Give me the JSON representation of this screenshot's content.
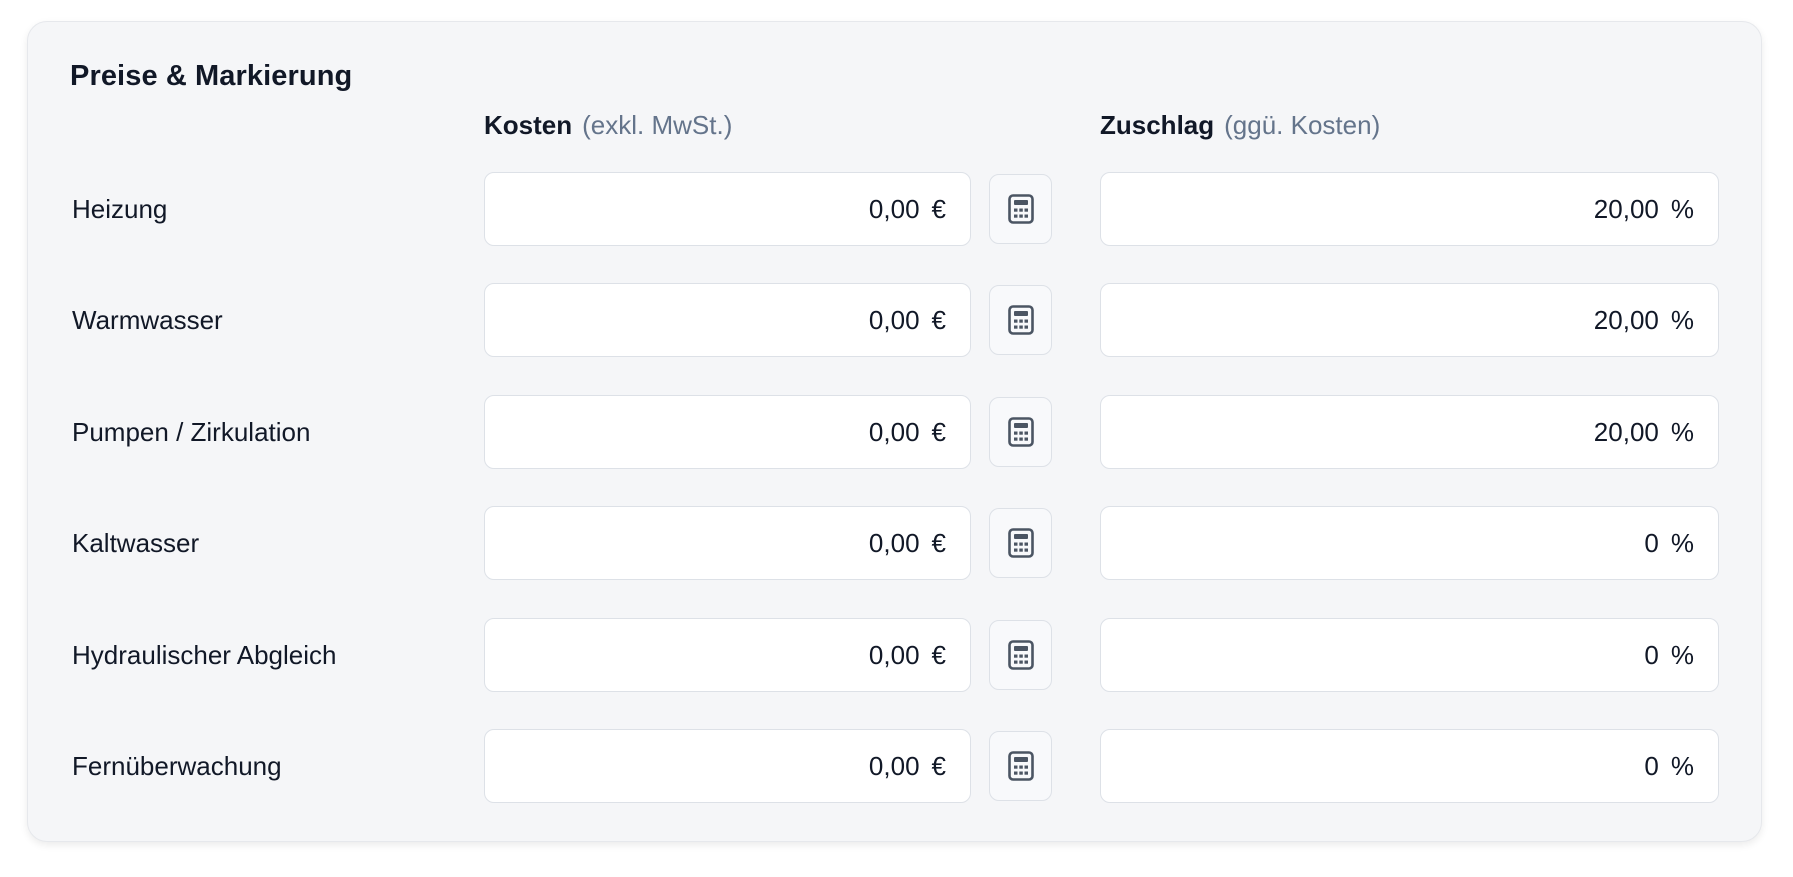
{
  "section": {
    "title": "Preise & Markierung"
  },
  "columns": {
    "cost": {
      "label": "Kosten",
      "hint": "(exkl. MwSt.)"
    },
    "markup": {
      "label": "Zuschlag",
      "hint": "(ggü. Kosten)"
    }
  },
  "rows": [
    {
      "label": "Heizung",
      "cost": "0,00",
      "cost_unit": "€",
      "markup": "20,00",
      "markup_unit": "%"
    },
    {
      "label": "Warmwasser",
      "cost": "0,00",
      "cost_unit": "€",
      "markup": "20,00",
      "markup_unit": "%"
    },
    {
      "label": "Pumpen / Zirkulation",
      "cost": "0,00",
      "cost_unit": "€",
      "markup": "20,00",
      "markup_unit": "%"
    },
    {
      "label": "Kaltwasser",
      "cost": "0,00",
      "cost_unit": "€",
      "markup": "0",
      "markup_unit": "%"
    },
    {
      "label": "Hydraulischer Abgleich",
      "cost": "0,00",
      "cost_unit": "€",
      "markup": "0",
      "markup_unit": "%"
    },
    {
      "label": "Fernüberwachung",
      "cost": "0,00",
      "cost_unit": "€",
      "markup": "0",
      "markup_unit": "%"
    }
  ],
  "icons": {
    "calculator": "calculator-icon"
  },
  "colors": {
    "card_background": "#f5f6f8",
    "field_border": "#dde1e7",
    "muted_text": "#64748b",
    "icon": "#4b5563"
  }
}
